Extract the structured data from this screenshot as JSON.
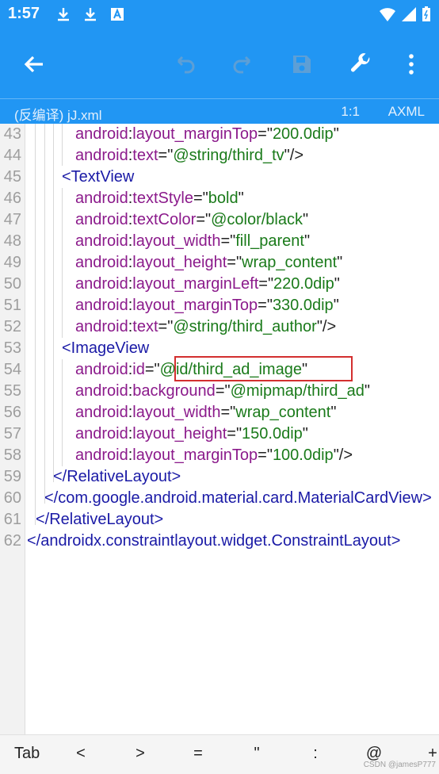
{
  "status_bar": {
    "time": "1:57",
    "icons_left": [
      "download-icon",
      "download-icon",
      "font-icon"
    ],
    "icons_right": [
      "wifi-icon",
      "signal-icon",
      "battery-icon"
    ]
  },
  "toolbar": {
    "back_icon": "arrow-back-icon",
    "undo_icon": "undo-icon",
    "redo_icon": "redo-icon",
    "save_icon": "save-icon",
    "tools_icon": "wrench-icon",
    "more_icon": "more-vert-icon",
    "accent": "#2196f3"
  },
  "file_bar": {
    "file_name": "(反编译) jJ.xml",
    "cursor_pos": "1:1",
    "file_type": "AXML"
  },
  "editor": {
    "lines": [
      {
        "num": "43",
        "attr": "android",
        "name": "layout_marginTop",
        "eq": "=\"",
        "val": "200.0dip",
        "end": "\""
      },
      {
        "num": "44",
        "attr": "android",
        "name": "text",
        "eq": "=\"",
        "val": "@string/third_tv",
        "end": "\"/>"
      },
      {
        "num": "45",
        "tag": "<TextView"
      },
      {
        "num": "46",
        "attr": "android",
        "name": "textStyle",
        "eq": "=\"",
        "val": "bold",
        "end": "\""
      },
      {
        "num": "47",
        "attr": "android",
        "name": "textColor",
        "eq": "=\"",
        "val": "@color/black",
        "end": "\""
      },
      {
        "num": "48",
        "attr": "android",
        "name": "layout_width",
        "eq": "=\"",
        "val": "fill_parent",
        "end": "\""
      },
      {
        "num": "49",
        "attr": "android",
        "name": "layout_height",
        "eq": "=\"",
        "val": "wrap_content",
        "end": "\""
      },
      {
        "num": "50",
        "attr": "android",
        "name": "layout_marginLeft",
        "eq": "=\"",
        "val": "220.0dip",
        "end": "\""
      },
      {
        "num": "51",
        "attr": "android",
        "name": "layout_marginTop",
        "eq": "=\"",
        "val": "330.0dip",
        "end": "\""
      },
      {
        "num": "52",
        "attr": "android",
        "name": "text",
        "eq": "=\"",
        "val": "@string/third_author",
        "end": "\"/>"
      },
      {
        "num": "53",
        "tag": "<ImageView"
      },
      {
        "num": "54",
        "attr": "android",
        "name": "id",
        "eq": "=\"",
        "val": "@id/third_ad_image",
        "end": "\""
      },
      {
        "num": "55",
        "attr": "android",
        "name": "background",
        "eq": "=\"",
        "val": "@mipmap/third_ad",
        "end": "\""
      },
      {
        "num": "56",
        "attr": "android",
        "name": "layout_width",
        "eq": "=\"",
        "val": "wrap_content",
        "end": "\""
      },
      {
        "num": "57",
        "attr": "android",
        "name": "layout_height",
        "eq": "=\"",
        "val": "150.0dip",
        "end": "\""
      },
      {
        "num": "58",
        "attr": "android",
        "name": "layout_marginTop",
        "eq": "=\"",
        "val": "100.0dip",
        "end": "\"/>"
      },
      {
        "num": "59",
        "tag": "</RelativeLayout>"
      },
      {
        "num": "60",
        "tag": "</com.google.android.material.card.MaterialCardView>"
      },
      {
        "num": "61",
        "tag": "</RelativeLayout>"
      },
      {
        "num": "62",
        "tag": "</androidx.constraintlayout.widget.ConstraintLayout>"
      }
    ]
  },
  "keybar": {
    "keys": [
      "Tab",
      "<",
      ">",
      "=",
      "\"",
      ":",
      "@",
      "+"
    ],
    "watermark": "CSDN @jamesP777"
  }
}
